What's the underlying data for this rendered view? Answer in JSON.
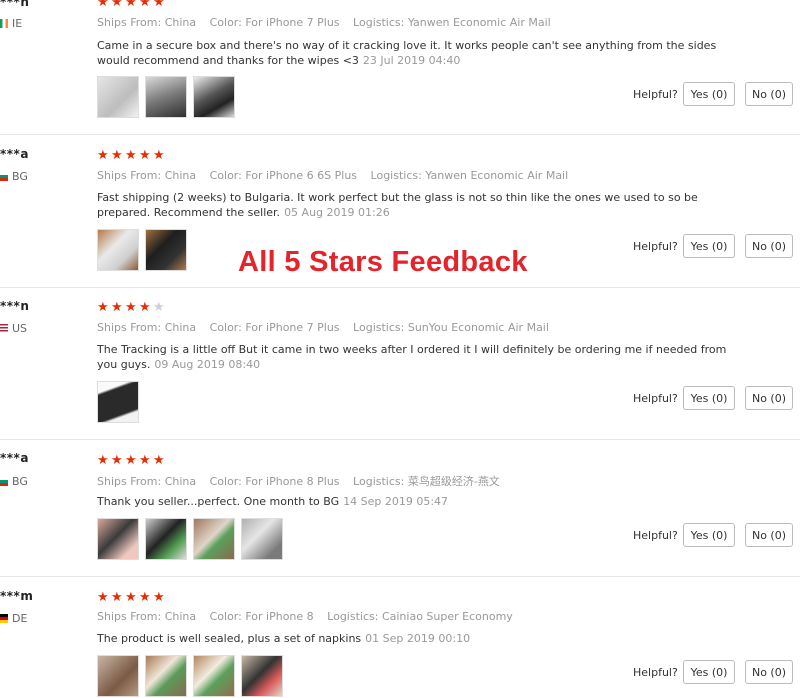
{
  "overlay_title": "All 5 Stars Feedback",
  "labels": {
    "ships_from": "Ships From:",
    "color": "Color:",
    "logistics": "Logistics:",
    "helpful": "Helpful?"
  },
  "colors": {
    "star": "#e62e04",
    "star_off": "#cfcfcf",
    "overlay": "#e4232b"
  },
  "reviews": [
    {
      "user": "***n",
      "country": "IE",
      "rating": 5,
      "ships_from": "China",
      "color": "For iPhone 7 Plus",
      "logistics": "Yanwen Economic Air Mail",
      "text": "Came in a secure box and there's no way of it cracking love it. It works people can't see anything from the sides would recommend and thanks for the wipes <3",
      "date": "23 Jul 2019 04:40",
      "yes": "Yes (0)",
      "no": "No (0)",
      "photos": 3
    },
    {
      "user": "***a",
      "country": "BG",
      "rating": 5,
      "ships_from": "China",
      "color": "For iPhone 6 6S Plus",
      "logistics": "Yanwen Economic Air Mail",
      "text": "Fast shipping (2 weeks) to Bulgaria. It work perfect but the glass is not so thin like the ones we used to so be prepared. Recommend the seller.",
      "date": "05 Aug 2019 01:26",
      "yes": "Yes (0)",
      "no": "No (0)",
      "photos": 2
    },
    {
      "user": "***n",
      "country": "US",
      "rating": 4,
      "ships_from": "China",
      "color": "For iPhone 7 Plus",
      "logistics": "SunYou Economic Air Mail",
      "text": "The Tracking is a little off But it came in two weeks after I ordered it I will definitely be ordering me if needed from you guys.",
      "date": "09 Aug 2019 08:40",
      "yes": "Yes (0)",
      "no": "No (0)",
      "photos": 1
    },
    {
      "user": "***a",
      "country": "BG",
      "rating": 5,
      "ships_from": "China",
      "color": "For iPhone 8 Plus",
      "logistics": "菜鸟超级经济-燕文",
      "text": "Thank you seller...perfect. One month to BG",
      "date": "14 Sep 2019 05:47",
      "yes": "Yes (0)",
      "no": "No (0)",
      "photos": 4
    },
    {
      "user": "***m",
      "country": "DE",
      "rating": 5,
      "ships_from": "China",
      "color": "For iPhone 8",
      "logistics": "Cainiao Super Economy",
      "text": "The product is well sealed, plus a set of napkins",
      "date": "01 Sep 2019 00:10",
      "yes": "Yes (0)",
      "no": "No (0)",
      "photos": 4
    }
  ]
}
